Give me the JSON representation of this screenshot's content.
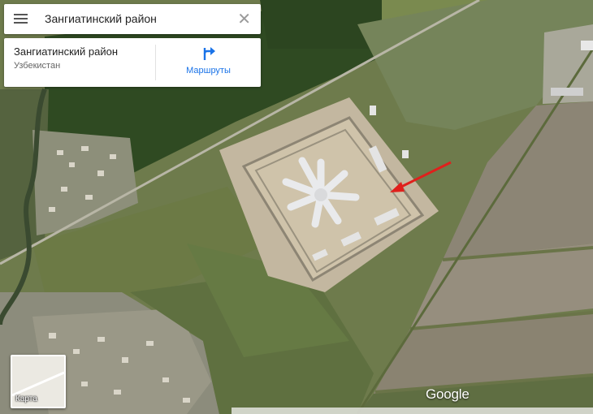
{
  "search": {
    "query": "Зангиатинский район"
  },
  "place": {
    "title": "Зангиатинский район",
    "subtitle": "Узбекистан"
  },
  "actions": {
    "routes_label": "Маршруты"
  },
  "layers": {
    "label": "Карта"
  },
  "brand": {
    "logo": "Google"
  },
  "icons": {
    "menu": "menu-icon",
    "close": "close-icon",
    "routes": "directions-icon"
  },
  "colors": {
    "accent": "#1a73e8",
    "arrow": "#e0201c"
  }
}
